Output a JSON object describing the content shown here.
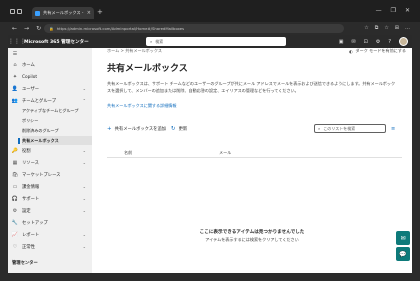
{
  "browser": {
    "tab_title": "共有メールボックス - Microsoft 365",
    "tab_close": "×",
    "new_tab": "+",
    "url": "https://admin.microsoft.com/Adminportal/Home#/SharedMailboxes",
    "win_controls": [
      "—",
      "❐",
      "✕"
    ],
    "nav_icons": [
      "←",
      "→",
      "↻",
      "⌂"
    ],
    "addr_icons": [
      "☆",
      "⧉",
      "☆",
      "⊞",
      "…"
    ]
  },
  "appbar": {
    "waffle": "⋮⋮⋮",
    "title": "Microsoft 365 管理センター",
    "search_placeholder": "検索",
    "icons": [
      "▣",
      "✉",
      "⊡",
      "⚙",
      "?"
    ]
  },
  "sidebar": {
    "collapse_icon": "☰",
    "items": [
      {
        "label": "ホーム",
        "icon": "⌂"
      },
      {
        "label": "Copilot",
        "icon": "✦"
      },
      {
        "label": "ユーザー",
        "icon": "👤",
        "chevron": "⌄"
      },
      {
        "label": "チームとグループ",
        "icon": "👥",
        "chevron": "⌃"
      }
    ],
    "sub_items": [
      {
        "label": "アクティブなチームとグループ"
      },
      {
        "label": "ポリシー"
      },
      {
        "label": "削除済みのグループ"
      },
      {
        "label": "共有メールボックス"
      }
    ],
    "items2": [
      {
        "label": "役割",
        "icon": "🔑",
        "chevron": "⌄"
      },
      {
        "label": "リソース",
        "icon": "▦",
        "chevron": "⌄"
      },
      {
        "label": "マーケットプレース",
        "icon": "🛍",
        "chevron": ""
      },
      {
        "label": "課金情報",
        "icon": "▭",
        "chevron": "⌄"
      },
      {
        "label": "サポート",
        "icon": "🎧",
        "chevron": "⌄"
      },
      {
        "label": "設定",
        "icon": "⚙",
        "chevron": "⌄"
      },
      {
        "label": "セットアップ",
        "icon": "🔧",
        "chevron": ""
      },
      {
        "label": "レポート",
        "icon": "📈",
        "chevron": "⌄"
      },
      {
        "label": "正常性",
        "icon": "♡",
        "chevron": "⌄"
      }
    ],
    "section_title": "管理センター"
  },
  "main": {
    "breadcrumb": "ホーム  >  共有メールボックス",
    "dark_mode": "ダーク モードを有効にする",
    "dark_mode_icon": "◐",
    "title": "共有メールボックス",
    "description": "共有メールボックスは、サポート チームなどのユーザーのグループが共にメール アドレスでメールを表示および送信できるようにします。共有メールボックスを選択して、メンバーの追加または削除、自動応答の設定、エイリアスの管理などを行ってください。",
    "learn_link": "共有メールボックスに関する詳細情報",
    "add_label": "共有メールボックスを追加",
    "add_icon": "+",
    "refresh_label": "更新",
    "refresh_icon": "↻",
    "list_search_placeholder": "このリストを検索",
    "search_icon": "⌕",
    "filter_icon": "≡",
    "columns": [
      "名前",
      "メール"
    ],
    "empty_title": "ここに表示できるアイテムは見つかりませんでした",
    "empty_subtitle": "アイテムを表示するには検索をクリアしてください"
  },
  "fabs": [
    "✉",
    "💬"
  ]
}
